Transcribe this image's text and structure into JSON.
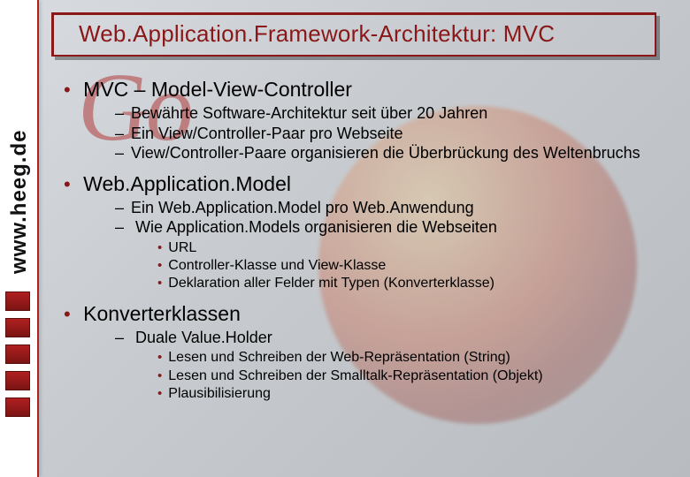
{
  "title": "Web.Application.Framework-Architektur: MVC",
  "watermark": {
    "brand": "Go",
    "url_text": "www.heeg.de"
  },
  "bullets": [
    {
      "label": "MVC – Model-View-Controller",
      "subs": [
        {
          "text": "Bewährte Software-Architektur seit über 20 Jahren"
        },
        {
          "text": "Ein View/Controller-Paar pro Webseite"
        },
        {
          "text": "View/Controller-Paare organisieren die Überbrückung des Weltenbruchs"
        }
      ]
    },
    {
      "label": "Web.Application.Model",
      "subs": [
        {
          "text": "Ein Web.Application.Model pro Web.Anwendung"
        },
        {
          "text": "Wie Application.Models organisieren die Webseiten",
          "subsubs": [
            "URL",
            "Controller-Klasse und View-Klasse",
            "Deklaration aller Felder mit Typen (Konverterklasse)"
          ]
        }
      ]
    },
    {
      "label": "Konverterklassen",
      "subs": [
        {
          "text": "Duale Value.Holder",
          "subsubs": [
            "Lesen und Schreiben der Web-Repräsentation (String)",
            "Lesen und Schreiben der Smalltalk-Repräsentation (Objekt)",
            "Plausibilisierung"
          ]
        }
      ]
    }
  ]
}
